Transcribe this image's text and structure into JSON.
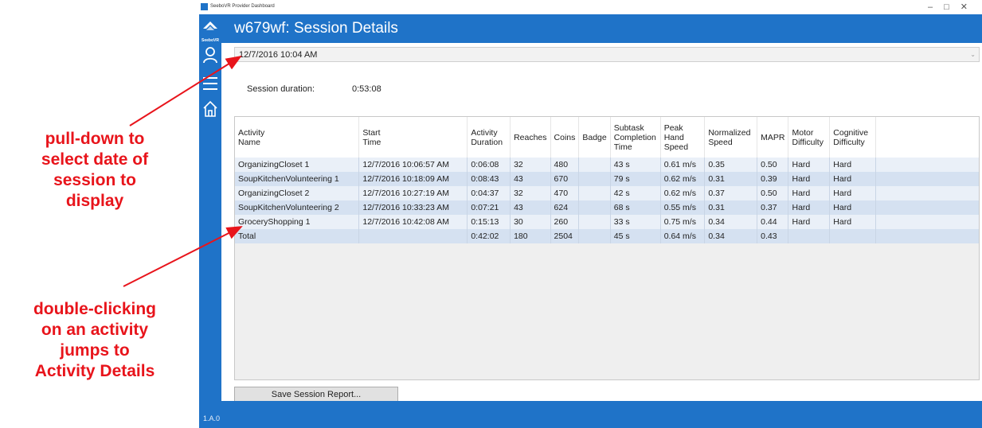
{
  "annotations": {
    "pulldown": [
      "pull-down to",
      "select date of",
      "session to",
      "display"
    ],
    "doubleclick": [
      "double-clicking",
      "on an activity",
      "jumps to",
      "Activity Details"
    ]
  },
  "window": {
    "title": "SeeboVR Provider Dashboard",
    "controls": [
      "–",
      "□",
      "✕"
    ]
  },
  "sidebar": {
    "logo_text": "SeeboVR",
    "icons": [
      "user-icon",
      "menu-icon",
      "home-icon"
    ],
    "version": "1.A.0"
  },
  "header": {
    "title": "w679wf: Session Details"
  },
  "date_select": {
    "value": "12/7/2016 10:04 AM"
  },
  "session": {
    "duration_label": "Session duration:",
    "duration_value": "0:53:08"
  },
  "table": {
    "columns": [
      [
        "Activity",
        "Name"
      ],
      [
        "Start",
        "Time"
      ],
      [
        "Activity",
        "Duration"
      ],
      [
        "Reaches"
      ],
      [
        "Coins"
      ],
      [
        "Badge"
      ],
      [
        "Subtask",
        "Completion",
        "Time"
      ],
      [
        "Peak",
        "Hand",
        "Speed"
      ],
      [
        "Normalized",
        "Speed"
      ],
      [
        "MAPR"
      ],
      [
        "Motor",
        "Difficulty"
      ],
      [
        "Cognitive",
        "Difficulty"
      ]
    ],
    "rows": [
      [
        "OrganizingCloset 1",
        "12/7/2016 10:06:57 AM",
        "0:06:08",
        "32",
        "480",
        "",
        "43 s",
        "0.61 m/s",
        "0.35",
        "0.50",
        "Hard",
        "Hard"
      ],
      [
        "SoupKitchenVolunteering 1",
        "12/7/2016 10:18:09 AM",
        "0:08:43",
        "43",
        "670",
        "",
        "79 s",
        "0.62 m/s",
        "0.31",
        "0.39",
        "Hard",
        "Hard"
      ],
      [
        "OrganizingCloset 2",
        "12/7/2016 10:27:19 AM",
        "0:04:37",
        "32",
        "470",
        "",
        "42 s",
        "0.62 m/s",
        "0.37",
        "0.50",
        "Hard",
        "Hard"
      ],
      [
        "SoupKitchenVolunteering 2",
        "12/7/2016 10:33:23 AM",
        "0:07:21",
        "43",
        "624",
        "",
        "68 s",
        "0.55 m/s",
        "0.31",
        "0.37",
        "Hard",
        "Hard"
      ],
      [
        "GroceryShopping 1",
        "12/7/2016 10:42:08 AM",
        "0:15:13",
        "30",
        "260",
        "",
        "33 s",
        "0.75 m/s",
        "0.34",
        "0.44",
        "Hard",
        "Hard"
      ],
      [
        "Total",
        "",
        "0:42:02",
        "180",
        "2504",
        "",
        "45 s",
        "0.64 m/s",
        "0.34",
        "0.43",
        "",
        ""
      ]
    ]
  },
  "actions": {
    "save_label": "Save Session Report..."
  }
}
